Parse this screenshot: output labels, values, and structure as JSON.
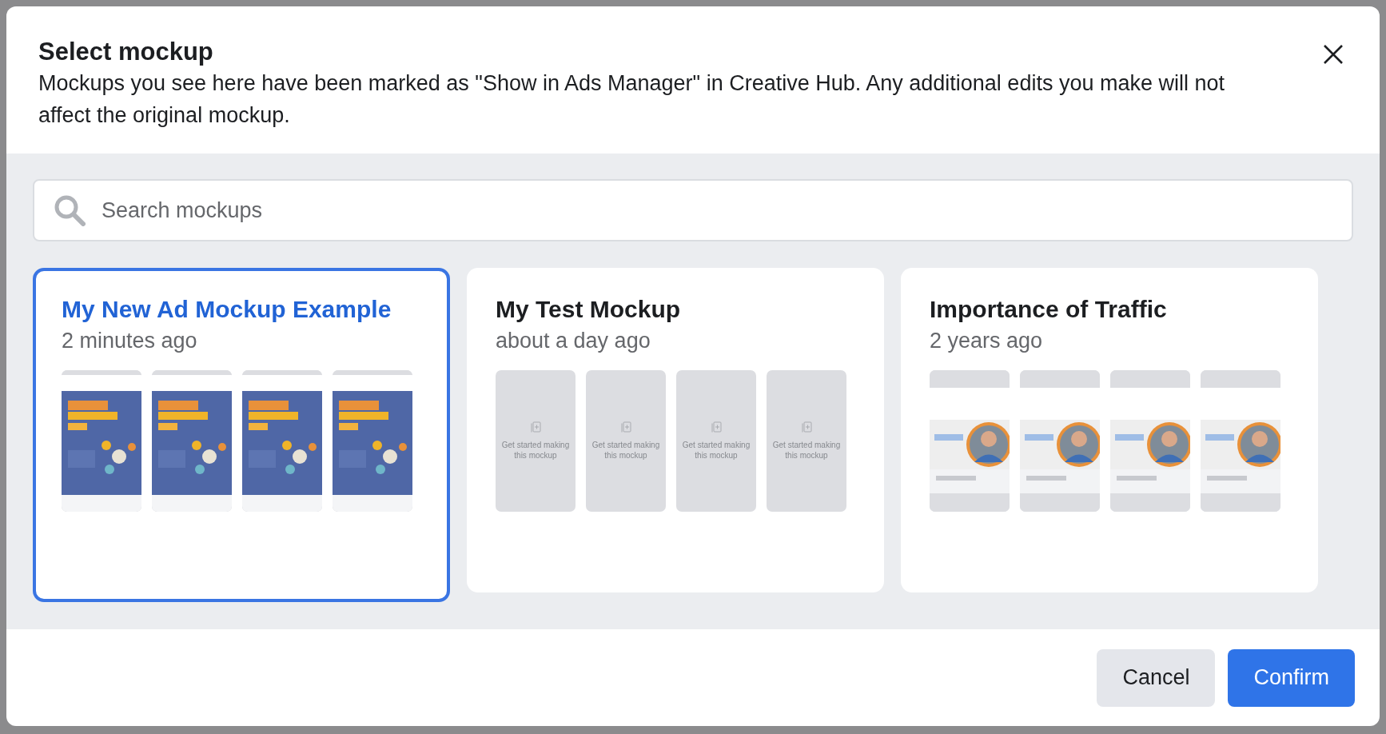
{
  "dialog": {
    "title": "Select mockup",
    "description": "Mockups you see here have been marked as \"Show in Ads Manager\" in Creative Hub. Any additional edits you make will not affect the original mockup.",
    "search": {
      "placeholder": "Search mockups"
    },
    "mockups": [
      {
        "name": "My New Ad Mockup Example",
        "time": "2 minutes ago",
        "selected": true
      },
      {
        "name": "My Test Mockup",
        "time": "about a day ago",
        "selected": false,
        "previews": [
          {
            "kind": "placeholder",
            "text": "Get started making this mockup"
          },
          {
            "kind": "placeholder",
            "text": "Get started making this mockup"
          },
          {
            "kind": "placeholder",
            "text": "Get started making this mockup"
          },
          {
            "kind": "placeholder",
            "text": "Get started making this mockup"
          }
        ]
      },
      {
        "name": "Importance of Traffic",
        "time": "2 years ago",
        "selected": false
      }
    ],
    "buttons": [
      {
        "label": "Cancel",
        "kind": "secondary"
      },
      {
        "label": "Confirm",
        "kind": "primary"
      }
    ]
  }
}
